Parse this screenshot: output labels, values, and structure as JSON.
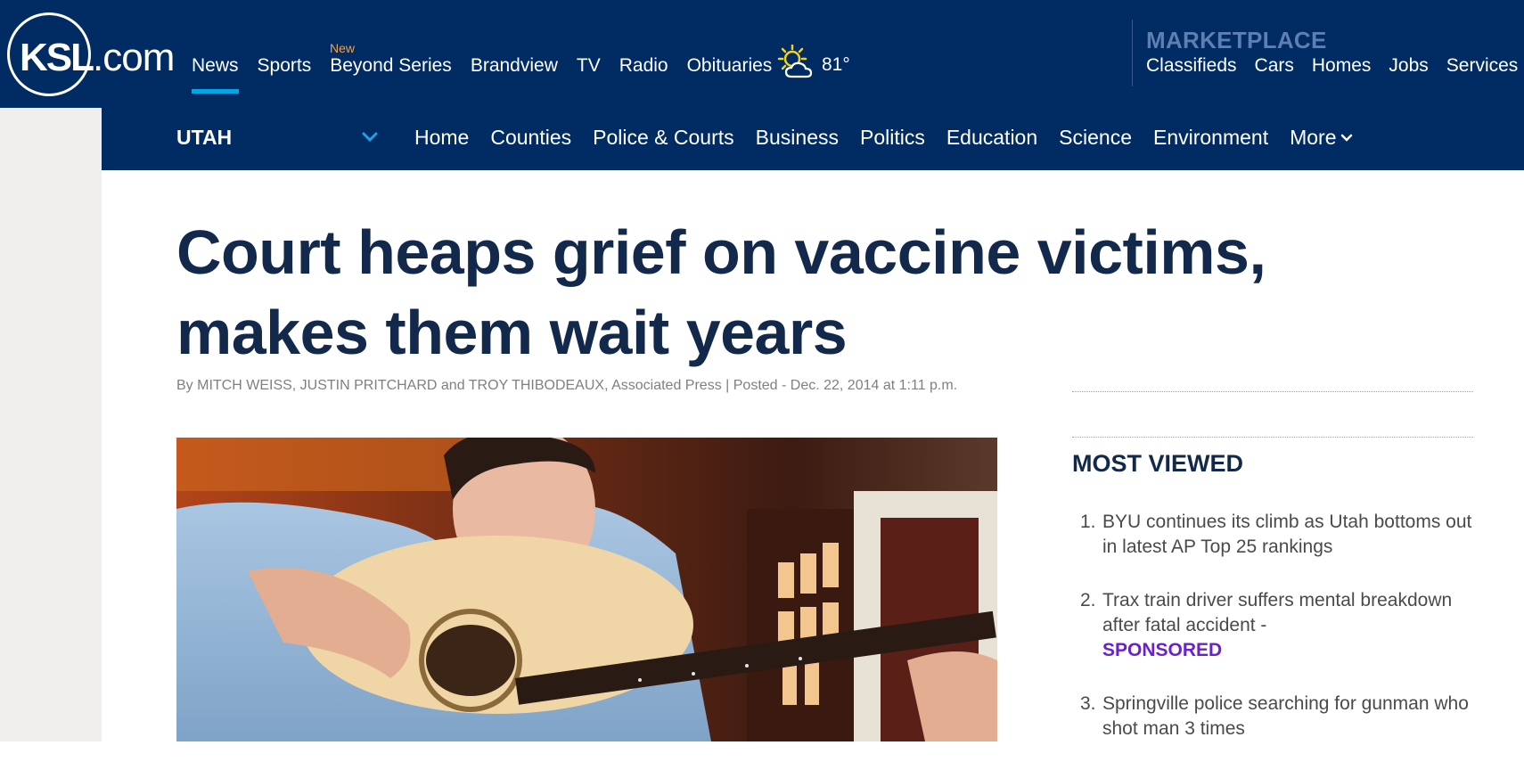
{
  "header": {
    "logo_main": "KSL",
    "logo_suffix": ".com",
    "nav": [
      {
        "label": "News",
        "active": true
      },
      {
        "label": "Sports"
      },
      {
        "label": "Beyond Series"
      },
      {
        "label": "Brandview"
      },
      {
        "label": "TV"
      },
      {
        "label": "Radio"
      },
      {
        "label": "Obituaries"
      }
    ],
    "new_badge": "New",
    "weather": {
      "icon": "partly-sunny-icon",
      "temp": "81°"
    },
    "marketplace": {
      "title": "MARKETPLACE",
      "nav": [
        "Classifieds",
        "Cars",
        "Homes",
        "Jobs",
        "Services"
      ]
    }
  },
  "subnav": {
    "section": "UTAH",
    "items": [
      "Home",
      "Counties",
      "Police & Courts",
      "Business",
      "Politics",
      "Education",
      "Science",
      "Environment",
      "More"
    ]
  },
  "article": {
    "headline": "Court heaps grief on vaccine victims, makes them wait years",
    "byline": "By MITCH WEISS, JUSTIN PRITCHARD and TROY THIBODEAUX, Associated Press | Posted - Dec. 22, 2014 at 1:11 p.m."
  },
  "most_viewed": {
    "title": "MOST VIEWED",
    "items": [
      {
        "num": "1.",
        "text": "BYU continues its climb as Utah bottoms out in latest AP Top 25 rankings",
        "sponsored": ""
      },
      {
        "num": "2.",
        "text": "Trax train driver suffers mental breakdown after fatal accident -",
        "sponsored": "SPONSORED"
      },
      {
        "num": "3.",
        "text": "Springville police searching for gunman who shot man 3 times",
        "sponsored": ""
      }
    ]
  },
  "colors": {
    "header_bg": "#002b63",
    "accent": "#00a6e6",
    "headline": "#13294b",
    "sponsored": "#6a1fd1"
  }
}
